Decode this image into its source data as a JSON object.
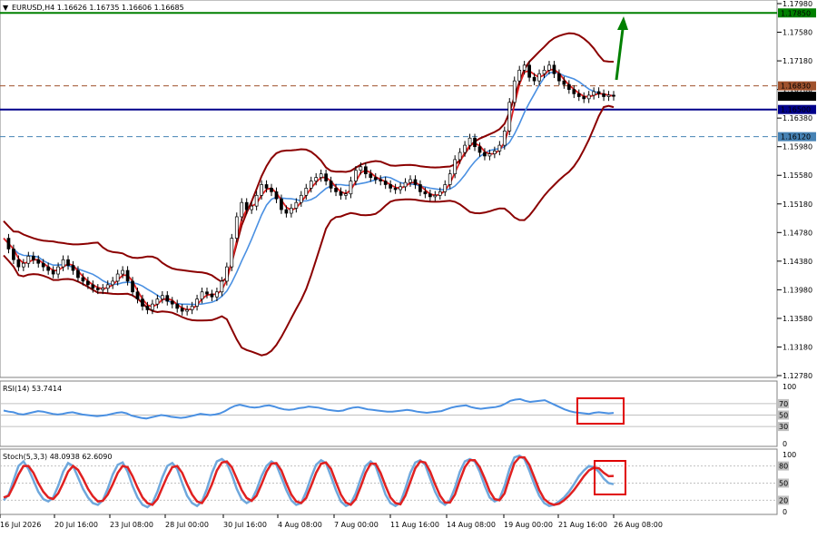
{
  "chart_data": {
    "type": "candlestick",
    "instrument_header": "EURUSD,H4  1.16626 1.16735 1.16606 1.16685",
    "price_axis": {
      "ylim": [
        1.1278,
        1.1798
      ],
      "ticks": [
        "1.17980",
        "1.17580",
        "1.17180",
        "1.16780",
        "1.16380",
        "1.15980",
        "1.15580",
        "1.15180",
        "1.14780",
        "1.14380",
        "1.13980",
        "1.13580",
        "1.13180",
        "1.12780"
      ]
    },
    "price_levels": [
      {
        "label": "1.17850",
        "value": 1.1785,
        "color": "#008000",
        "style": "solid"
      },
      {
        "label": "1.16830",
        "value": 1.1683,
        "color": "#a0522d",
        "style": "dashed"
      },
      {
        "label": "1.16685",
        "value": 1.16685,
        "color": "#000000",
        "style": "current"
      },
      {
        "label": "1.16500",
        "value": 1.165,
        "color": "#00008b",
        "style": "solid"
      },
      {
        "label": "1.16120",
        "value": 1.1612,
        "color": "#4682b4",
        "style": "dashed"
      }
    ],
    "x_ticks": [
      "16 Jul 2026",
      "20 Jul 16:00",
      "23 Jul 08:00",
      "28 Jul 00:00",
      "30 Jul 16:00",
      "4 Aug 08:00",
      "7 Aug 00:00",
      "11 Aug 16:00",
      "14 Aug 08:00",
      "19 Aug 00:00",
      "21 Aug 16:00",
      "26 Aug 08:00"
    ],
    "close_series": [
      1.147,
      1.1455,
      1.144,
      1.143,
      1.1435,
      1.1445,
      1.144,
      1.1435,
      1.143,
      1.1425,
      1.142,
      1.143,
      1.144,
      1.1432,
      1.1425,
      1.1415,
      1.141,
      1.1405,
      1.14,
      1.1398,
      1.14,
      1.1405,
      1.141,
      1.142,
      1.1425,
      1.141,
      1.1395,
      1.1385,
      1.1375,
      1.137,
      1.1378,
      1.1385,
      1.139,
      1.1382,
      1.1378,
      1.1372,
      1.1368,
      1.137,
      1.1375,
      1.1385,
      1.1395,
      1.1392,
      1.1388,
      1.1395,
      1.141,
      1.143,
      1.147,
      1.15,
      1.152,
      1.151,
      1.1515,
      1.153,
      1.1545,
      1.154,
      1.1535,
      1.1525,
      1.151,
      1.1505,
      1.1512,
      1.152,
      1.153,
      1.154,
      1.155,
      1.1555,
      1.156,
      1.155,
      1.154,
      1.1535,
      1.153,
      1.1532,
      1.155,
      1.1565,
      1.157,
      1.156,
      1.1555,
      1.1552,
      1.155,
      1.1545,
      1.154,
      1.1538,
      1.1542,
      1.1548,
      1.1552,
      1.1545,
      1.1535,
      1.1532,
      1.1528,
      1.153,
      1.1535,
      1.1545,
      1.156,
      1.158,
      1.159,
      1.16,
      1.161,
      1.1598,
      1.159,
      1.1585,
      1.1588,
      1.1592,
      1.16,
      1.162,
      1.166,
      1.169,
      1.1705,
      1.1712,
      1.1695,
      1.169,
      1.17,
      1.1705,
      1.1712,
      1.17,
      1.169,
      1.1685,
      1.1678,
      1.1672,
      1.1668,
      1.1665,
      1.167,
      1.1675,
      1.1672,
      1.1668,
      1.167,
      1.16685
    ],
    "indicators": [
      "Moving averages",
      "Bollinger Bands"
    ],
    "annotations": [
      "green up arrow"
    ],
    "rsi": {
      "label": "RSI(14) 53.7414",
      "ylim": [
        0,
        100
      ],
      "axis_ticks": [
        "100",
        "0"
      ],
      "level_tags": [
        "70",
        "50",
        "30"
      ],
      "series": [
        58,
        56,
        55,
        52,
        51,
        53,
        55,
        57,
        56,
        54,
        52,
        51,
        52,
        54,
        55,
        53,
        51,
        50,
        49,
        48,
        49,
        50,
        52,
        54,
        55,
        53,
        49,
        47,
        45,
        44,
        46,
        48,
        50,
        49,
        47,
        46,
        45,
        46,
        48,
        50,
        52,
        51,
        50,
        51,
        53,
        57,
        62,
        66,
        68,
        66,
        64,
        63,
        64,
        66,
        67,
        65,
        62,
        60,
        59,
        60,
        62,
        63,
        65,
        64,
        63,
        61,
        59,
        58,
        57,
        58,
        61,
        63,
        64,
        62,
        60,
        59,
        58,
        57,
        56,
        56,
        57,
        58,
        59,
        58,
        56,
        55,
        54,
        55,
        56,
        57,
        60,
        63,
        65,
        66,
        67,
        64,
        62,
        61,
        62,
        63,
        64,
        66,
        70,
        75,
        77,
        78,
        75,
        73,
        74,
        75,
        76,
        72,
        68,
        64,
        60,
        57,
        55,
        54,
        53,
        52,
        54,
        55,
        54,
        53,
        53.7414
      ]
    },
    "stochastic": {
      "label": "Stoch(5,3,3) 48.0938 62.6090",
      "ylim": [
        0,
        100
      ],
      "axis_ticks": [
        "100",
        "0"
      ],
      "level_tags": [
        "80",
        "50",
        "20"
      ],
      "main": [
        20,
        30,
        55,
        80,
        88,
        75,
        55,
        35,
        22,
        18,
        25,
        45,
        70,
        85,
        80,
        60,
        40,
        25,
        15,
        12,
        20,
        40,
        65,
        82,
        86,
        70,
        45,
        25,
        12,
        8,
        15,
        35,
        60,
        80,
        85,
        75,
        50,
        28,
        15,
        10,
        18,
        40,
        68,
        88,
        92,
        85,
        65,
        40,
        22,
        15,
        20,
        38,
        62,
        80,
        88,
        82,
        60,
        38,
        20,
        12,
        15,
        35,
        60,
        82,
        90,
        85,
        62,
        38,
        18,
        10,
        14,
        32,
        58,
        80,
        88,
        80,
        55,
        30,
        15,
        10,
        16,
        40,
        68,
        86,
        90,
        82,
        58,
        35,
        18,
        12,
        20,
        42,
        70,
        88,
        92,
        88,
        70,
        45,
        25,
        18,
        22,
        45,
        75,
        95,
        98,
        92,
        72,
        48,
        28,
        15,
        10,
        12,
        18,
        25,
        35,
        48,
        62,
        72,
        80,
        78,
        70,
        58,
        50,
        48.0938
      ],
      "signal": [
        25,
        28,
        45,
        65,
        80,
        80,
        68,
        50,
        35,
        25,
        22,
        32,
        50,
        70,
        80,
        73,
        58,
        40,
        27,
        18,
        19,
        30,
        48,
        68,
        80,
        78,
        62,
        42,
        25,
        15,
        12,
        22,
        42,
        62,
        78,
        80,
        68,
        48,
        30,
        18,
        15,
        28,
        48,
        72,
        86,
        88,
        78,
        58,
        38,
        24,
        19,
        28,
        48,
        70,
        84,
        85,
        72,
        50,
        30,
        18,
        15,
        24,
        45,
        68,
        84,
        86,
        75,
        52,
        30,
        16,
        12,
        22,
        44,
        68,
        84,
        84,
        68,
        45,
        25,
        15,
        13,
        28,
        52,
        76,
        88,
        86,
        70,
        48,
        28,
        16,
        16,
        30,
        55,
        78,
        90,
        90,
        78,
        58,
        36,
        22,
        20,
        32,
        60,
        85,
        95,
        95,
        82,
        60,
        38,
        22,
        15,
        12,
        14,
        20,
        28,
        38,
        50,
        62,
        72,
        77,
        76,
        68,
        62,
        62.609
      ]
    }
  }
}
